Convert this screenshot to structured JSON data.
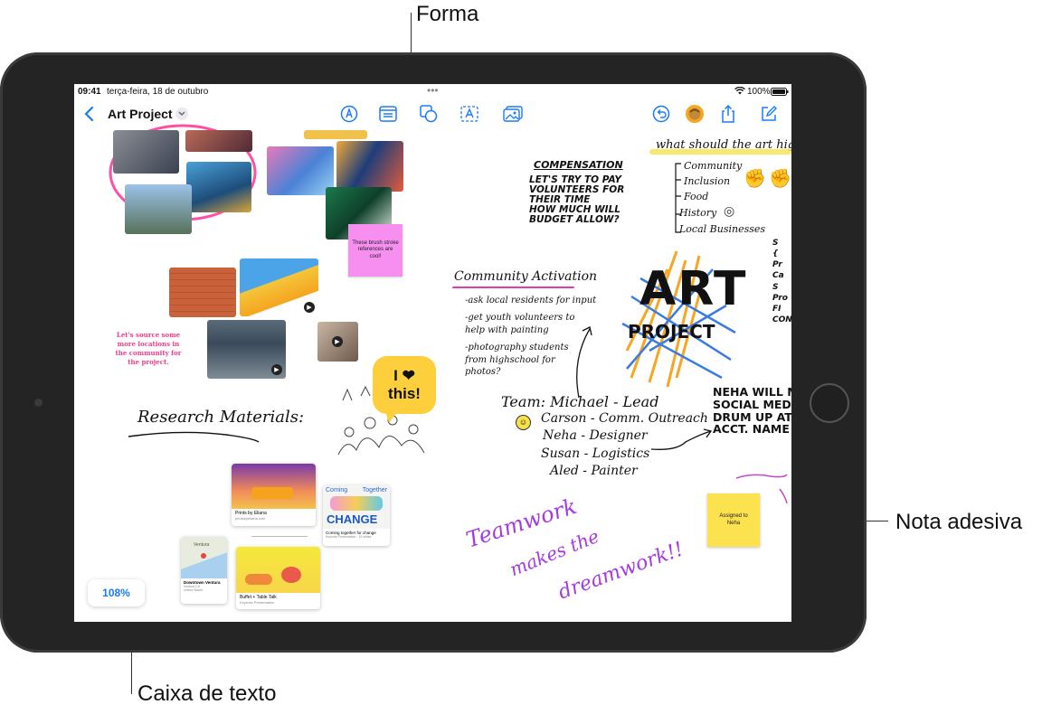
{
  "callouts": {
    "shape": "Forma",
    "sticky_note": "Nota adesiva",
    "text_box": "Caixa de texto"
  },
  "status_bar": {
    "time": "09:41",
    "date": "terça-feira, 18 de outubro",
    "battery": "100%"
  },
  "toolbar": {
    "back_icon": "chevron-left-icon",
    "title": "Art Project",
    "title_menu_icon": "chevron-down-icon",
    "tools": [
      "pen-icon",
      "text-box-icon",
      "shapes-icon",
      "text-icon",
      "media-icon"
    ],
    "right": [
      "undo-icon",
      "collaborator-icon",
      "share-icon",
      "compose-icon"
    ]
  },
  "canvas": {
    "sticky_pink": "These brush stroke references are cool!",
    "textbox_pink": "Let's source some more locations in the community for the project.",
    "shape_bubble": "I ❤ this!",
    "research_heading": "Research Materials:",
    "compensation": {
      "title": "COMPENSATION",
      "body": "LET'S TRY TO PAY\nVOLUNTEERS FOR\nTHEIR TIME\nHOW MUCH WILL\nBUDGET ALLOW?"
    },
    "highlight_title": "what should the art highlight",
    "highlight_items": [
      "Community",
      "Inclusion",
      "Food",
      "History",
      "Local Businesses"
    ],
    "community_activation": {
      "title": "Community Activation",
      "items": [
        "-ask local residents for input",
        "-get youth volunteers to help with painting",
        "-photography students from highschool for photos?"
      ]
    },
    "art_project": [
      "ART",
      "PROJECT"
    ],
    "team": {
      "title": "Team: Michael - Lead",
      "members": [
        "Carson - Comm. Outreach",
        "Neha - Designer",
        "Susan - Logistics",
        "Aled - Painter"
      ]
    },
    "neha_note": "NEHA WILL M\nSOCIAL MEDIA A\nDRUM UP ATTE\nACCT. NAME",
    "teamwork": [
      "Teamwork",
      "makes the",
      "dreamwork!!"
    ],
    "sticky_yellow": "Assigned to Neha",
    "zoom": "108%",
    "cards": {
      "prints": {
        "title": "Prints by Eliana",
        "sub": "printsbyeliana.com"
      },
      "change": {
        "top_left": "Coming",
        "top_right": "Together",
        "big": "CHANGE",
        "title": "Coming together for change",
        "sub": "Keynote Presentation · 15 slides"
      },
      "map": {
        "place": "Ventura",
        "title": "Downtown Ventura",
        "sub": "Ventura CA\nUnited States"
      },
      "buffet": {
        "title": "Buffet + Table Talk",
        "sub": "Keynote Presentation"
      }
    }
  }
}
